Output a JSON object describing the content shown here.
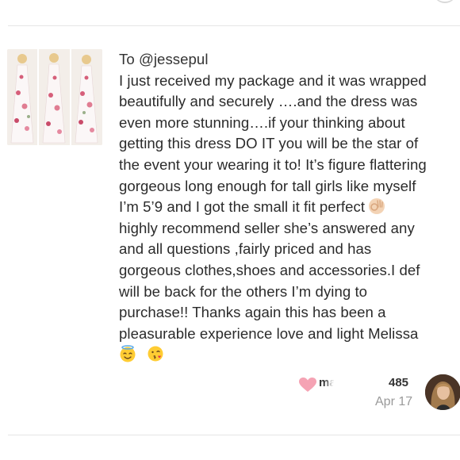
{
  "listing": {
    "thumbnail_icon": "dress-photo-collage"
  },
  "comment": {
    "recipient": "To @jessepul",
    "lines": [
      "I just received my package and it was wrapped",
      "beautifully and securely ….and the dress was",
      "even more stunning….if your thinking about",
      "getting this dress DO IT you will be the star of",
      "the event your wearing it to! It’s figure flattering",
      "gorgeous long enough for tall girls like myself",
      "I’m 5’9 and I got the small it fit perfect",
      "highly recommend seller she’s answered any",
      "and all questions ,fairly priced and has",
      "gorgeous clothes,shoes and accessories.I def",
      "will be back for the others I’m dying to",
      "purchase!! Thanks again this has been a",
      "pleasurable experience love and light Melissa"
    ],
    "emoji_ok": "ok-hand-emoji",
    "emoji_end": [
      "smiling-face-with-halo-emoji",
      "face-blowing-kiss-emoji"
    ]
  },
  "author": {
    "username_start": "ma",
    "username_end": "485",
    "date": "Apr 17",
    "heart_color": "#f5a3b4",
    "avatar_icon": "user-avatar"
  }
}
